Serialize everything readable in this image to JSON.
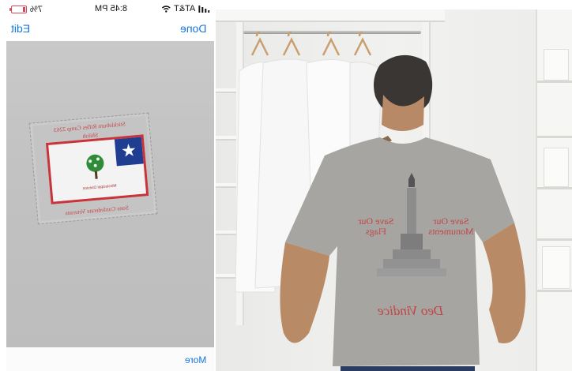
{
  "status_bar": {
    "battery": "7%",
    "time": "8:45 PM",
    "carrier": "AT&T"
  },
  "nav": {
    "edit_label": "Edit",
    "done_label": "Done"
  },
  "toolbar": {
    "more_label": "More"
  },
  "pocket_print": {
    "top_line": "Stickleburn Rifles Camp 2263",
    "sub_line": "Shiloh",
    "flag_caption": "Mississippi Division",
    "bottom_line": "Sons Confederate Veterans"
  },
  "shirt_back": {
    "left_text": "Save Our Flags",
    "right_text": "Save Our Monuments",
    "motto": "Deo Vindice"
  },
  "colors": {
    "ios_blue": "#1677e0",
    "print_red": "#c24646",
    "flag_blue": "#1f3d91",
    "shirt_gray": "#a6a5a1"
  }
}
